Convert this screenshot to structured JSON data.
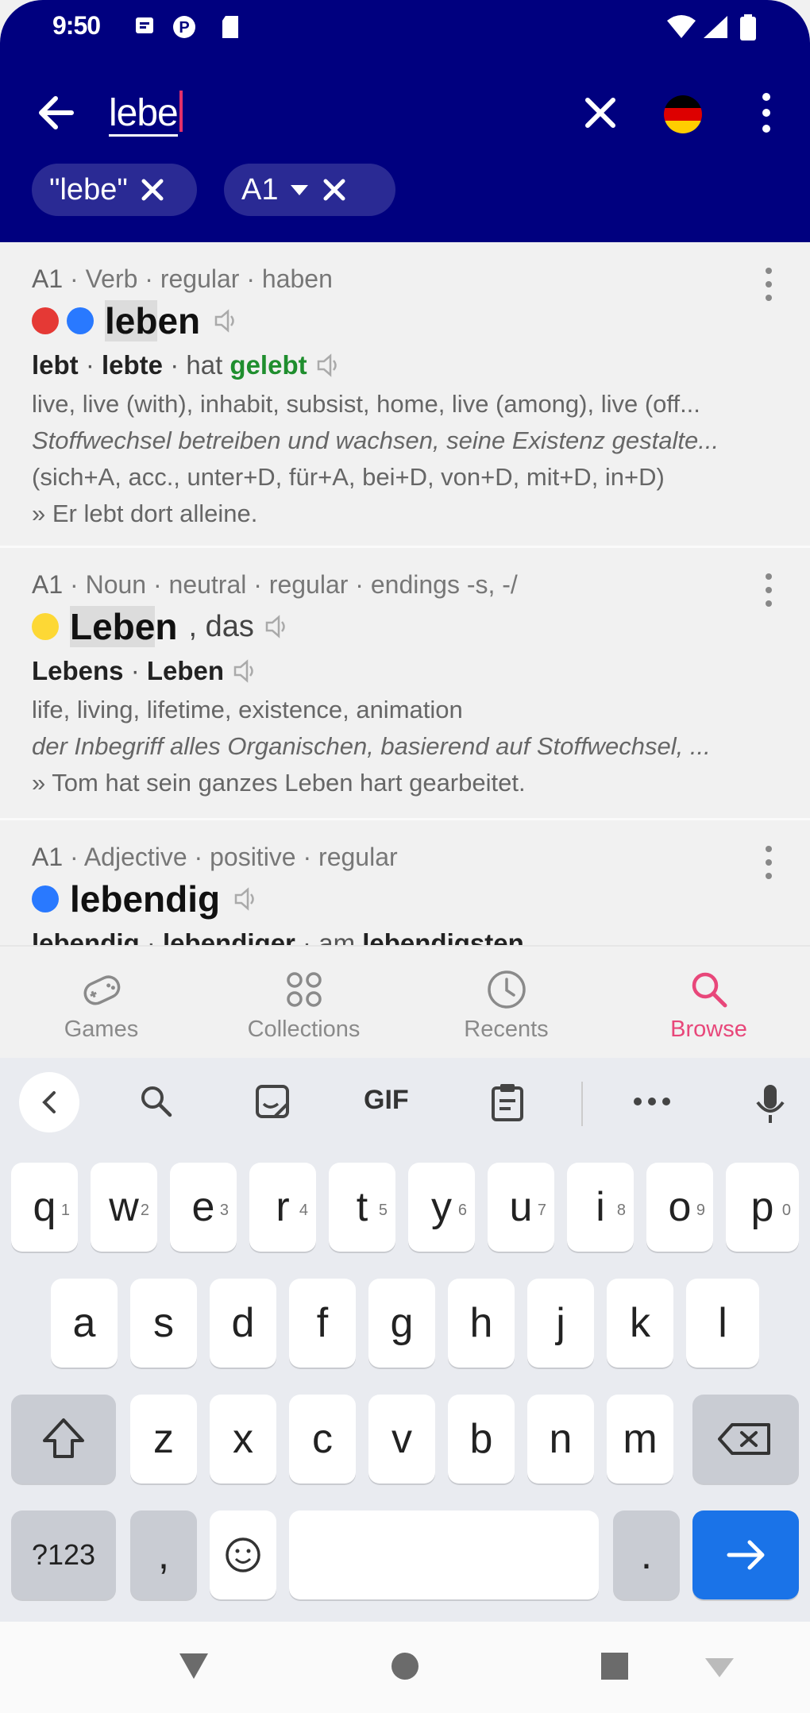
{
  "status_bar": {
    "time": "9:50"
  },
  "search": {
    "query_typed": "lebe"
  },
  "filters": [
    {
      "label": "\"lebe\""
    },
    {
      "label": "A1"
    }
  ],
  "results": [
    {
      "level": "A1",
      "meta": " · Verb · regular · haben",
      "dots": [
        "#e53935",
        "#2979ff"
      ],
      "word_hl": "leb",
      "word_rest": "en",
      "article": "",
      "forms": [
        {
          "t": "lebt",
          "b": true
        },
        {
          "t": " · ",
          "b": false
        },
        {
          "t": "lebte",
          "b": true
        },
        {
          "t": " · hat ",
          "b": false
        },
        {
          "t": "gelebt",
          "b": true
        }
      ],
      "lines": [
        "live, live (with), inhabit, subsist, home, live (among), live (off...",
        "Stoffwechsel betreiben und wachsen, seine Existenz gestalte...",
        "(sich+A, acc., unter+D, für+A, bei+D, von+D, mit+D, in+D)",
        "» Er lebt dort alleine."
      ]
    },
    {
      "level": "A1",
      "meta": " · Noun · neutral · regular · endings -s, -/",
      "dots": [
        "#fdd835"
      ],
      "word_hl": "Lebe",
      "word_rest": "n",
      "article": ", das",
      "forms": [
        {
          "t": "Lebens",
          "b": true
        },
        {
          "t": " · ",
          "b": false
        },
        {
          "t": "Leben",
          "b": true
        }
      ],
      "lines": [
        "life, living, lifetime, existence, animation",
        "der Inbegriff alles Organischen, basierend auf Stoffwechsel, ...",
        "» Tom hat sein ganzes Leben hart gearbeitet."
      ]
    },
    {
      "level": "A1",
      "meta": " · Adjective · positive · regular",
      "dots": [
        "#2979ff"
      ],
      "word_hl": "",
      "word_rest": "lebendig",
      "article": "",
      "forms": [
        {
          "t": "lebendig",
          "b": true
        },
        {
          "t": " · ",
          "b": false
        },
        {
          "t": "lebendiger",
          "b": true
        },
        {
          "t": " · am ",
          "b": false
        },
        {
          "t": "lebendigsten",
          "b": true
        }
      ],
      "lines": []
    }
  ],
  "bottom_nav": [
    {
      "label": "Games",
      "icon": "games-icon"
    },
    {
      "label": "Collections",
      "icon": "collections-icon"
    },
    {
      "label": "Recents",
      "icon": "clock-icon"
    },
    {
      "label": "Browse",
      "icon": "search-icon",
      "active": true
    }
  ],
  "keyboard": {
    "suggestion_gif": "GIF",
    "row1": [
      {
        "k": "q",
        "h": "1"
      },
      {
        "k": "w",
        "h": "2"
      },
      {
        "k": "e",
        "h": "3"
      },
      {
        "k": "r",
        "h": "4"
      },
      {
        "k": "t",
        "h": "5"
      },
      {
        "k": "y",
        "h": "6"
      },
      {
        "k": "u",
        "h": "7"
      },
      {
        "k": "i",
        "h": "8"
      },
      {
        "k": "o",
        "h": "9"
      },
      {
        "k": "p",
        "h": "0"
      }
    ],
    "row2": [
      "a",
      "s",
      "d",
      "f",
      "g",
      "h",
      "j",
      "k",
      "l"
    ],
    "row3": [
      "z",
      "x",
      "c",
      "v",
      "b",
      "n",
      "m"
    ],
    "symbols_label": "?123",
    "comma": ",",
    "period": "."
  },
  "colors": {
    "header": "#00007f",
    "accent": "#e8477a",
    "enter": "#1a73e8"
  }
}
